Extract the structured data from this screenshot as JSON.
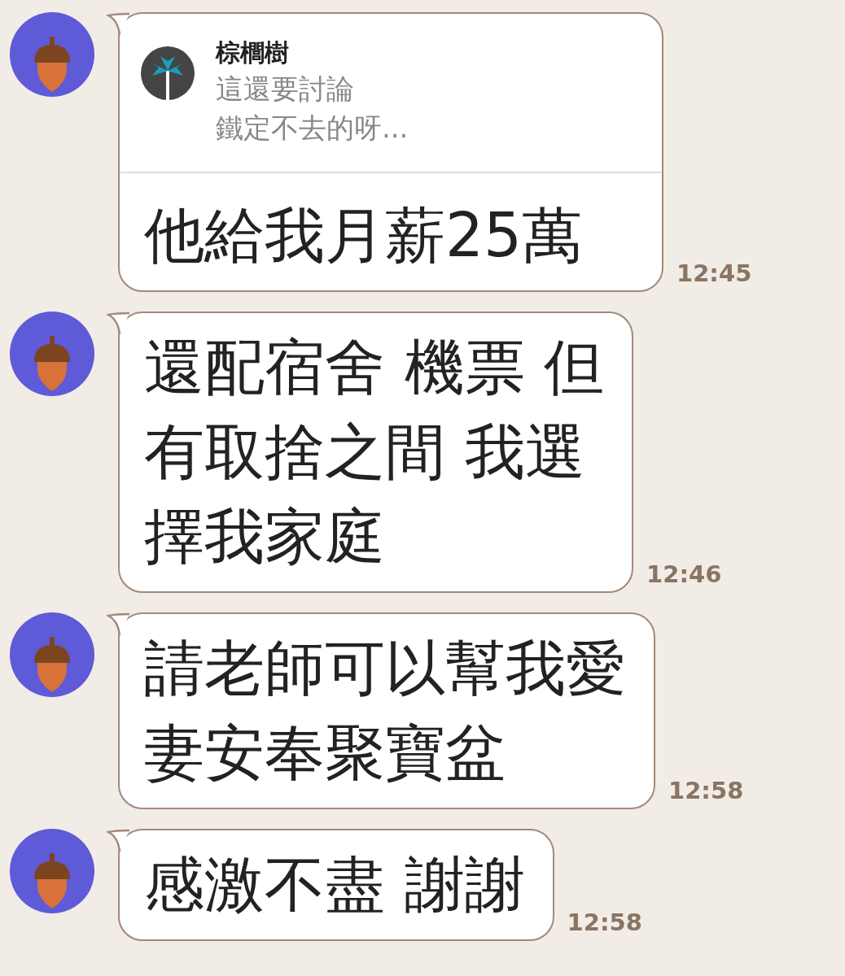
{
  "messages": [
    {
      "kind": "reply",
      "quote": {
        "name": "棕櫚樹",
        "lines": [
          "這還要討論",
          "鐵定不去的呀..."
        ]
      },
      "lines": [
        "他給我月薪25萬"
      ],
      "time": "12:45"
    },
    {
      "kind": "text",
      "lines": [
        "還配宿舍 機票 但",
        "有取捨之間 我選",
        "擇我家庭"
      ],
      "time": "12:46"
    },
    {
      "kind": "text",
      "lines": [
        "請老師可以幫我愛",
        "妻安奉聚寶盆"
      ],
      "time": "12:58"
    },
    {
      "kind": "text",
      "lines": [
        "感激不盡 謝謝"
      ],
      "time": "12:58"
    }
  ]
}
